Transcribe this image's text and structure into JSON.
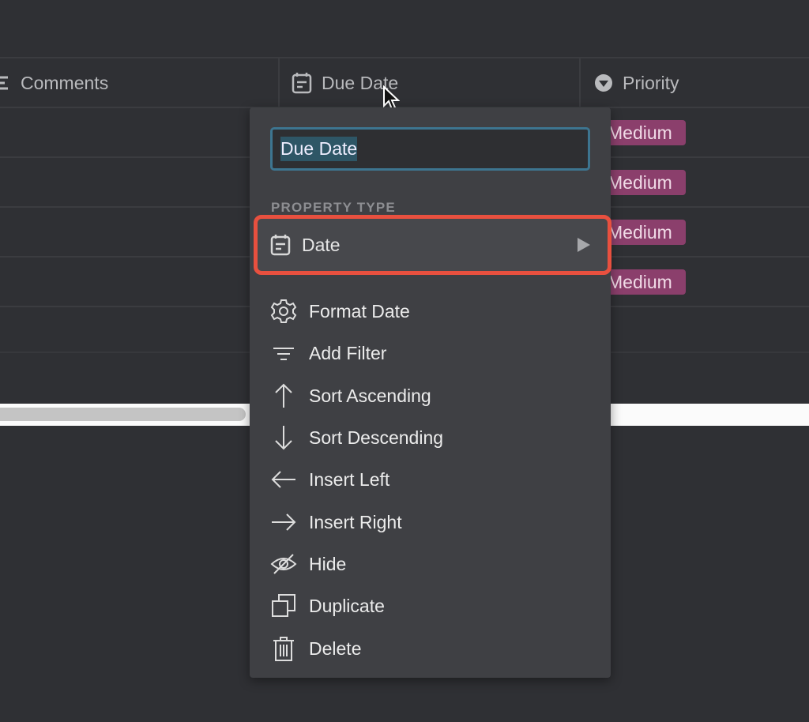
{
  "columns": [
    {
      "label": "Comments",
      "icon": "text-lines-icon"
    },
    {
      "label": "Due Date",
      "icon": "calendar-icon"
    },
    {
      "label": "Priority",
      "icon": "select-dropdown-icon"
    }
  ],
  "priority_badges": [
    "Medium",
    "Medium",
    "Medium",
    "Medium"
  ],
  "menu": {
    "name_value": "Due Date",
    "section_label": "PROPERTY TYPE",
    "property_type": "Date",
    "items": [
      {
        "label": "Format Date",
        "icon": "gear-icon"
      },
      {
        "label": "Add Filter",
        "icon": "filter-icon"
      },
      {
        "label": "Sort Ascending",
        "icon": "arrow-up-icon"
      },
      {
        "label": "Sort Descending",
        "icon": "arrow-down-icon"
      },
      {
        "label": "Insert Left",
        "icon": "arrow-left-icon"
      },
      {
        "label": "Insert Right",
        "icon": "arrow-right-icon"
      },
      {
        "label": "Hide",
        "icon": "eye-off-icon"
      },
      {
        "label": "Duplicate",
        "icon": "duplicate-icon"
      },
      {
        "label": "Delete",
        "icon": "trash-icon"
      }
    ]
  },
  "colors": {
    "highlight": "#e8503f",
    "badge": "#8b3f6c",
    "focus": "#3d7590"
  }
}
